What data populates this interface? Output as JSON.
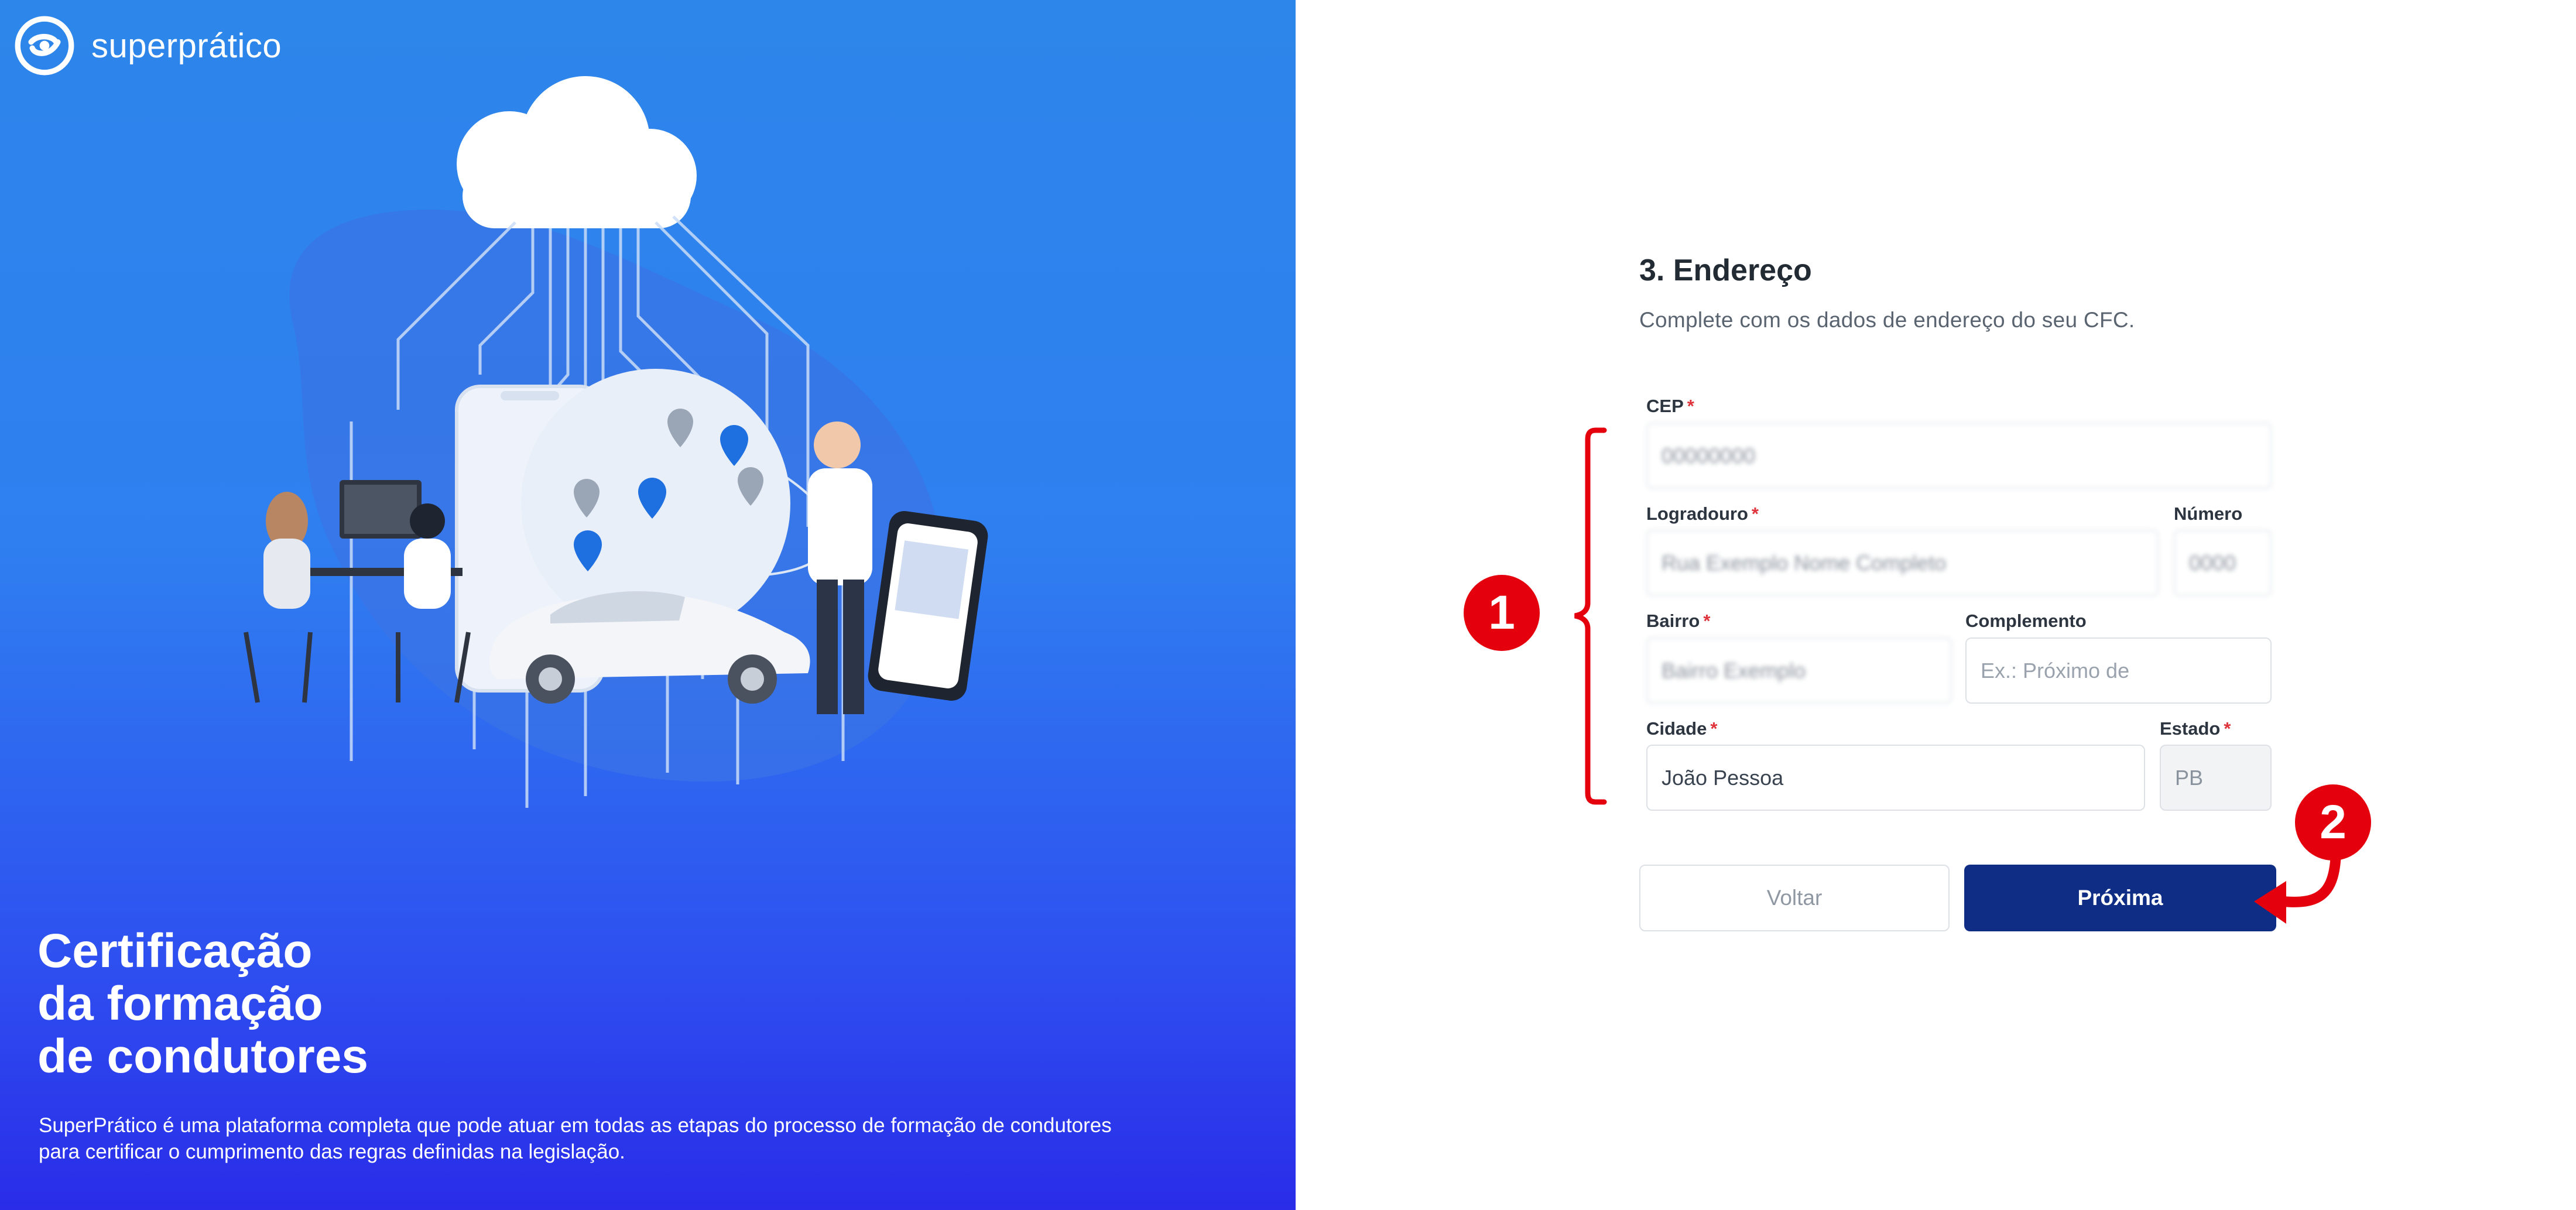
{
  "brand": {
    "name": "superprático"
  },
  "hero": {
    "title_lines": [
      "Certificação",
      "da formação",
      "de condutores"
    ],
    "description": "SuperPrático é uma plataforma completa que pode atuar em todas as etapas do processo de formação de condutores para certificar o cumprimento das regras definidas na legislação."
  },
  "form": {
    "title": "3. Endereço",
    "subtitle": "Complete com os dados de endereço do seu CFC.",
    "fields": {
      "cep": {
        "label": "CEP",
        "value": "00000000"
      },
      "logradouro": {
        "label": "Logradouro",
        "value": "Rua Exemplo Nome Completo"
      },
      "numero": {
        "label": "Número",
        "value": "0000"
      },
      "bairro": {
        "label": "Bairro",
        "value": "Bairro Exemplo"
      },
      "complemento": {
        "label": "Complemento",
        "placeholder": "Ex.: Próximo de"
      },
      "cidade": {
        "label": "Cidade",
        "value": "João Pessoa"
      },
      "estado": {
        "label": "Estado",
        "value": "PB"
      }
    },
    "required_mark": "*",
    "buttons": {
      "back": "Voltar",
      "next": "Próxima"
    }
  },
  "annotations": {
    "badge_1": "1",
    "badge_2": "2"
  },
  "colors": {
    "hero_top": "#2d86ea",
    "hero_bottom": "#2a2ce8",
    "primary_button": "#0f2d84",
    "annotation_red": "#e5000e",
    "required_red": "#e0343c"
  }
}
